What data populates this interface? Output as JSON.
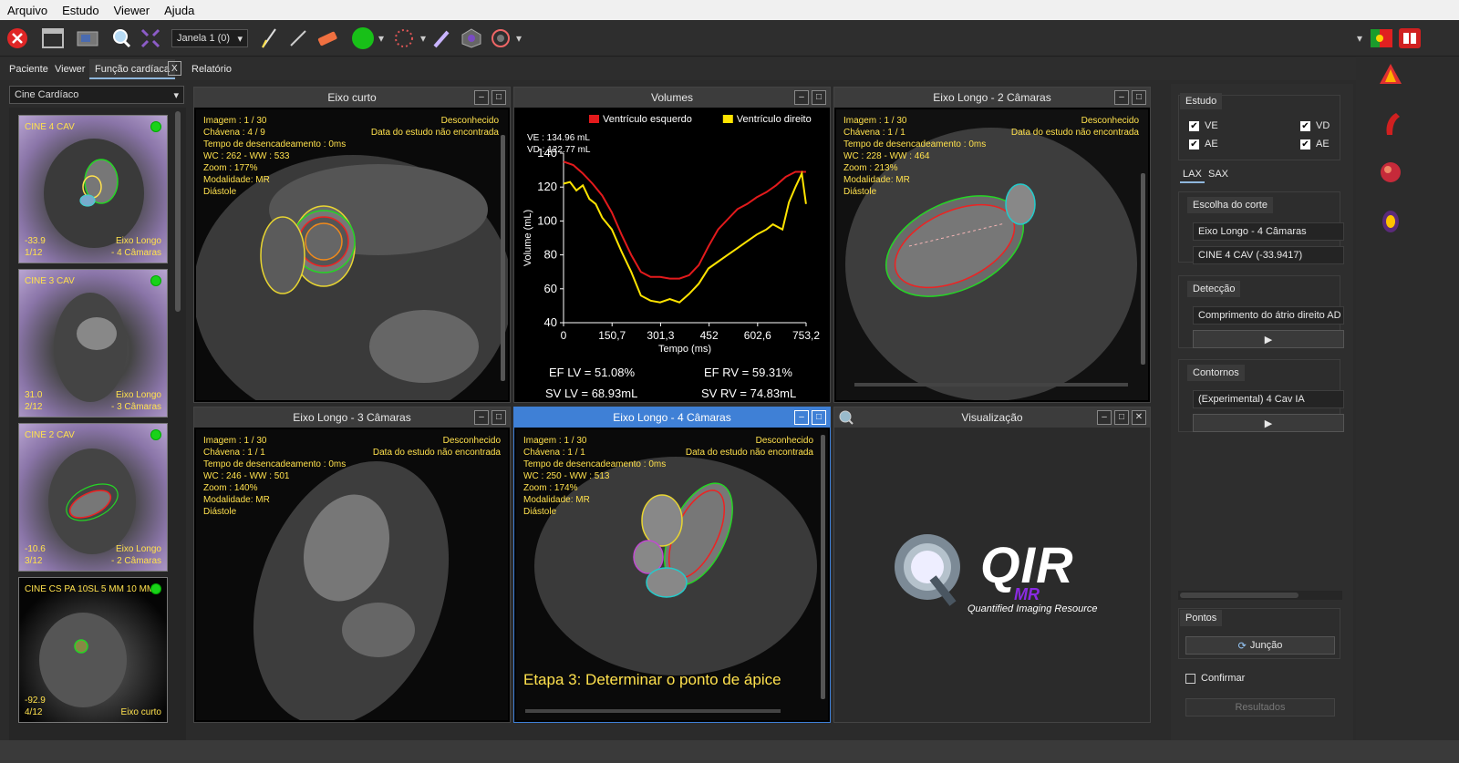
{
  "menu": [
    "Arquivo",
    "Estudo",
    "Viewer",
    "Ajuda"
  ],
  "toolbar": {
    "window_select": "Janela 1 (0)"
  },
  "tabs": [
    "Paciente",
    "Viewer",
    "Função cardíaca",
    "Relatório"
  ],
  "tab_close": "X",
  "left": {
    "series_combo": "Cine Cardíaco",
    "thumbs": [
      {
        "title": "CINE 4 CAV",
        "bl1": "-33.9",
        "bl2": "1/12",
        "br1": "Eixo Longo",
        "br2": "- 4 Câmaras"
      },
      {
        "title": "CINE 3 CAV",
        "bl1": "31.0",
        "bl2": "2/12",
        "br1": "Eixo Longo",
        "br2": "- 3 Câmaras"
      },
      {
        "title": "CINE 2 CAV",
        "bl1": "-10.6",
        "bl2": "3/12",
        "br1": "Eixo Longo",
        "br2": "- 2 Câmaras"
      },
      {
        "title": "CINE CS PA 10SL 5 MM 10 MM",
        "bl1": "-92.9",
        "bl2": "4/12",
        "br1": "",
        "br2": "Eixo curto"
      }
    ]
  },
  "panels": {
    "short_axis": {
      "title": "Eixo curto",
      "l": [
        "Imagem : 1 / 30",
        "Chávena : 4 / 9",
        "Tempo de desencadeamento : 0ms",
        "WC : 262 - WW : 533",
        "Zoom : 177%",
        "Modalidade: MR",
        "Diástole"
      ],
      "r": [
        "Desconhecido",
        "Data do estudo não encontrada"
      ]
    },
    "two_ch": {
      "title": "Eixo Longo - 2 Câmaras",
      "l": [
        "Imagem : 1 / 30",
        "Chávena : 1 / 1",
        "Tempo de desencadeamento : 0ms",
        "WC : 228 - WW : 464",
        "Zoom : 213%",
        "Modalidade: MR",
        "Diástole"
      ],
      "r": [
        "Desconhecido",
        "Data do estudo não encontrada"
      ]
    },
    "three_ch": {
      "title": "Eixo Longo - 3 Câmaras",
      "l": [
        "Imagem : 1 / 30",
        "Chávena : 1 / 1",
        "Tempo de desencadeamento : 0ms",
        "WC : 246 - WW : 501",
        "Zoom : 140%",
        "Modalidade: MR",
        "Diástole"
      ],
      "r": [
        "Desconhecido",
        "Data do estudo não encontrada"
      ]
    },
    "four_ch": {
      "title": "Eixo Longo - 4 Câmaras",
      "l": [
        "Imagem : 1 / 30",
        "Chávena : 1 / 1",
        "Tempo de desencadeamento : 0ms",
        "WC : 250 - WW : 513",
        "Zoom : 174%",
        "Modalidade: MR",
        "Diástole"
      ],
      "r": [
        "Desconhecido",
        "Data do estudo não encontrada"
      ],
      "step": "Etapa 3: Determinar o ponto de ápice"
    },
    "visual": {
      "title": "Visualização",
      "logo_main": "QIR",
      "logo_sub": "MR",
      "logo_tag": "Quantified Imaging Resource"
    }
  },
  "volumes": {
    "title": "Volumes",
    "ve": "VE : 134.96 mL",
    "vd": "VD : 122.77 mL",
    "ef_lv": "EF LV = 51.08%",
    "ef_rv": "EF RV = 59.31%",
    "sv_lv": "SV LV = 68.93mL",
    "sv_rv": "SV RV = 74.83mL"
  },
  "chart_data": {
    "type": "line",
    "xlabel": "Tempo (ms)",
    "ylabel": "Volume (mL)",
    "xlim": [
      0,
      753.2
    ],
    "ylim": [
      40,
      140
    ],
    "xticks": [
      "0",
      "150,7",
      "301,3",
      "452",
      "602,6",
      "753,2"
    ],
    "yticks": [
      "40",
      "60",
      "80",
      "100",
      "120",
      "140"
    ],
    "legend_position": "top",
    "series": [
      {
        "name": "Ventrículo esquerdo",
        "color": "#e31a1c",
        "x": [
          0,
          30,
          60,
          90,
          120,
          150,
          180,
          210,
          240,
          270,
          300,
          330,
          360,
          390,
          420,
          450,
          480,
          510,
          540,
          570,
          600,
          630,
          660,
          690,
          720,
          753
        ],
        "y": [
          135,
          133,
          128,
          122,
          115,
          105,
          92,
          80,
          70,
          67,
          67,
          66,
          66,
          68,
          74,
          85,
          95,
          101,
          107,
          110,
          114,
          117,
          121,
          126,
          129,
          129
        ]
      },
      {
        "name": "Ventrículo direito",
        "color": "#ffe400",
        "x": [
          0,
          20,
          40,
          60,
          80,
          100,
          120,
          150,
          180,
          210,
          240,
          270,
          300,
          330,
          360,
          390,
          420,
          450,
          480,
          510,
          540,
          570,
          600,
          630,
          650,
          680,
          700,
          720,
          740,
          753
        ],
        "y": [
          122,
          123,
          118,
          121,
          113,
          110,
          102,
          95,
          82,
          70,
          56,
          53,
          52,
          54,
          52,
          57,
          63,
          72,
          76,
          80,
          84,
          88,
          92,
          95,
          98,
          95,
          111,
          120,
          128,
          110
        ]
      }
    ]
  },
  "right": {
    "estudo_label": "Estudo",
    "checks": [
      {
        "label": "VE"
      },
      {
        "label": "VD"
      },
      {
        "label": "AE"
      },
      {
        "label": "AE"
      }
    ],
    "subtabs": [
      "LAX",
      "SAX"
    ],
    "escolha_label": "Escolha do corte",
    "escolha1": "Eixo Longo - 4 Câmaras",
    "escolha2": "CINE 4 CAV (-33.9417)",
    "deteccao_label": "Detecção",
    "deteccao_field": "Comprimento do átrio direito AD",
    "contornos_label": "Contornos",
    "contornos_field": "(Experimental) 4 Cav IA",
    "pontos_label": "Pontos",
    "juncao": "Junção",
    "confirmar": "Confirmar",
    "resultados": "Resultados"
  }
}
